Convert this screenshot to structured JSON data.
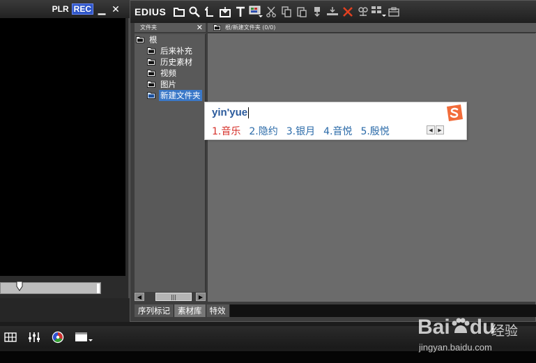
{
  "player": {
    "plr_label": "PLR",
    "rec_label": "REC",
    "minimize_glyph": "▁",
    "close_glyph": "✕"
  },
  "bin": {
    "app_label": "EDIUS",
    "toolbar_icons": [
      "folder-icon",
      "search-icon",
      "up-folder-icon",
      "import-icon",
      "title-icon",
      "monitor-icon",
      "cut-icon",
      "copy-icon",
      "paste-icon",
      "add-to-player-icon",
      "add-to-timeline-icon",
      "delete-icon",
      "properties-icon",
      "view-icon",
      "bin-icon"
    ],
    "tree": {
      "title": "文件夹",
      "close_glyph": "✕",
      "root": "根",
      "folders": [
        {
          "label": "后来补充",
          "selected": false
        },
        {
          "label": "历史素材",
          "selected": false
        },
        {
          "label": "视频",
          "selected": false
        },
        {
          "label": "图片",
          "selected": false
        },
        {
          "label": "新建文件夹",
          "selected": true
        }
      ]
    },
    "content_path": "根/新建文件夹 (0/0)",
    "scroll_thumb_glyph": "|||",
    "tabs": [
      {
        "label": "序列标记",
        "active": false
      },
      {
        "label": "素材库",
        "active": true
      },
      {
        "label": "特效",
        "active": false
      }
    ]
  },
  "ime": {
    "input": "yin'yue",
    "candidates": [
      "1.音乐",
      "2.隐约",
      "3.银月",
      "4.音悦",
      "5.殷悦"
    ],
    "logo_icon": "sogou-s-icon"
  },
  "bottom_icons": [
    "grid-icon",
    "mixer-icon",
    "color-wheel-icon",
    "layout-dropdown-icon"
  ],
  "watermark": {
    "logo": "Bai",
    "logo_suffix": "du",
    "jingyan": "经验",
    "url": "jingyan.baidu.com"
  },
  "colors": {
    "rec_bg": "#2f56c8",
    "selected_folder": "#3a78c8",
    "ime_input": "#2a5a9c",
    "ime_first_candidate": "#d6302a",
    "ime_candidate": "#2a6aa8",
    "delete_icon": "#e04020",
    "sogou_logo": "#f26c3a"
  }
}
